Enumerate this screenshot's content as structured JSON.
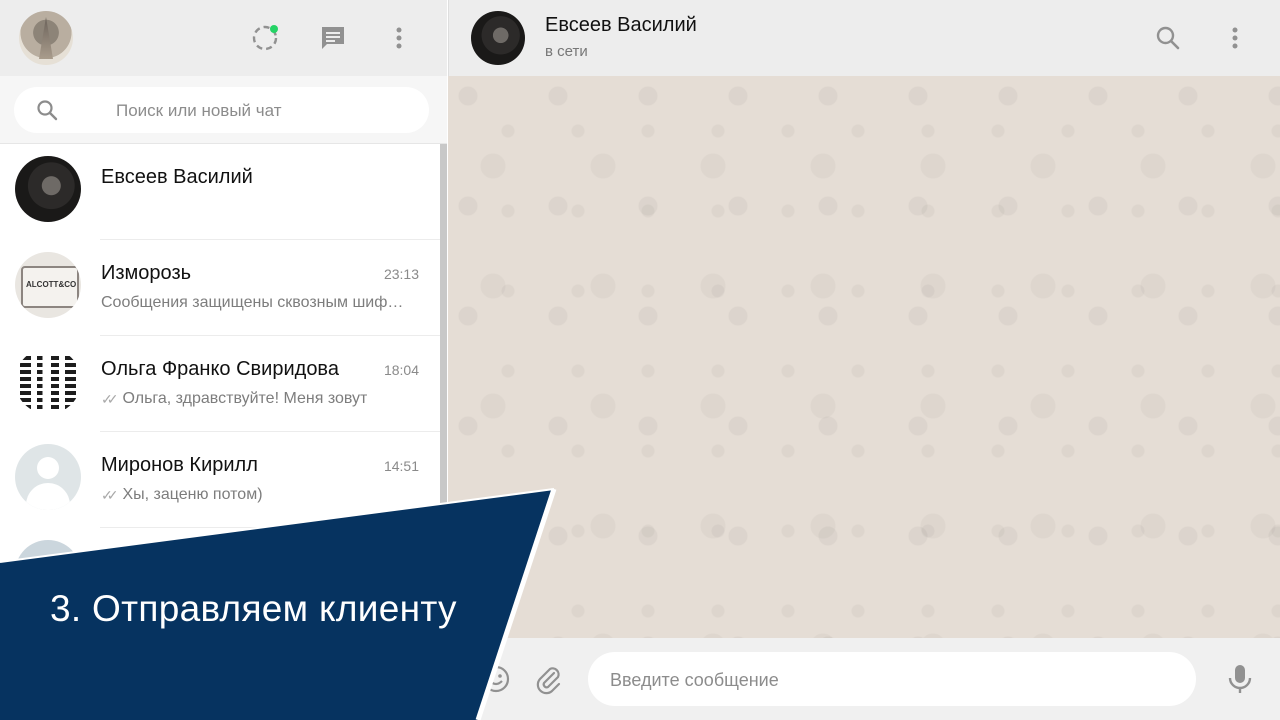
{
  "colors": {
    "header_bg": "#ededed",
    "chat_bg": "#e5ddd5",
    "status_dot": "#25d366",
    "banner_bg": "#063360",
    "banner_border": "#ffffff"
  },
  "sidebar": {
    "icons": {
      "status": "status-icon",
      "new_chat": "new-chat-icon",
      "menu": "menu-dots-icon"
    },
    "search": {
      "placeholder": "Поиск или новый чат"
    },
    "chats": [
      {
        "name": "Евсеев Василий",
        "time": "",
        "preview": "",
        "ticks": false
      },
      {
        "name": "Изморозь",
        "time": "23:13",
        "preview": "Сообщения защищены сквозным шифрованием",
        "ticks": false
      },
      {
        "name": "Ольга Франко Свиридова",
        "time": "18:04",
        "preview": "Ольга, здравствуйте! Меня зовут",
        "ticks": true
      },
      {
        "name": "Миронов Кирилл",
        "time": "14:51",
        "preview": "Хы, заценю потом)",
        "ticks": true
      }
    ],
    "avatar_labels": {
      "shirt": "ALCOTT&CO"
    }
  },
  "conversation": {
    "contact_name": "Евсеев Василий",
    "contact_status": "в сети",
    "compose_placeholder": "Введите сообщение"
  },
  "overlay": {
    "caption": "3. Отправляем клиенту"
  }
}
